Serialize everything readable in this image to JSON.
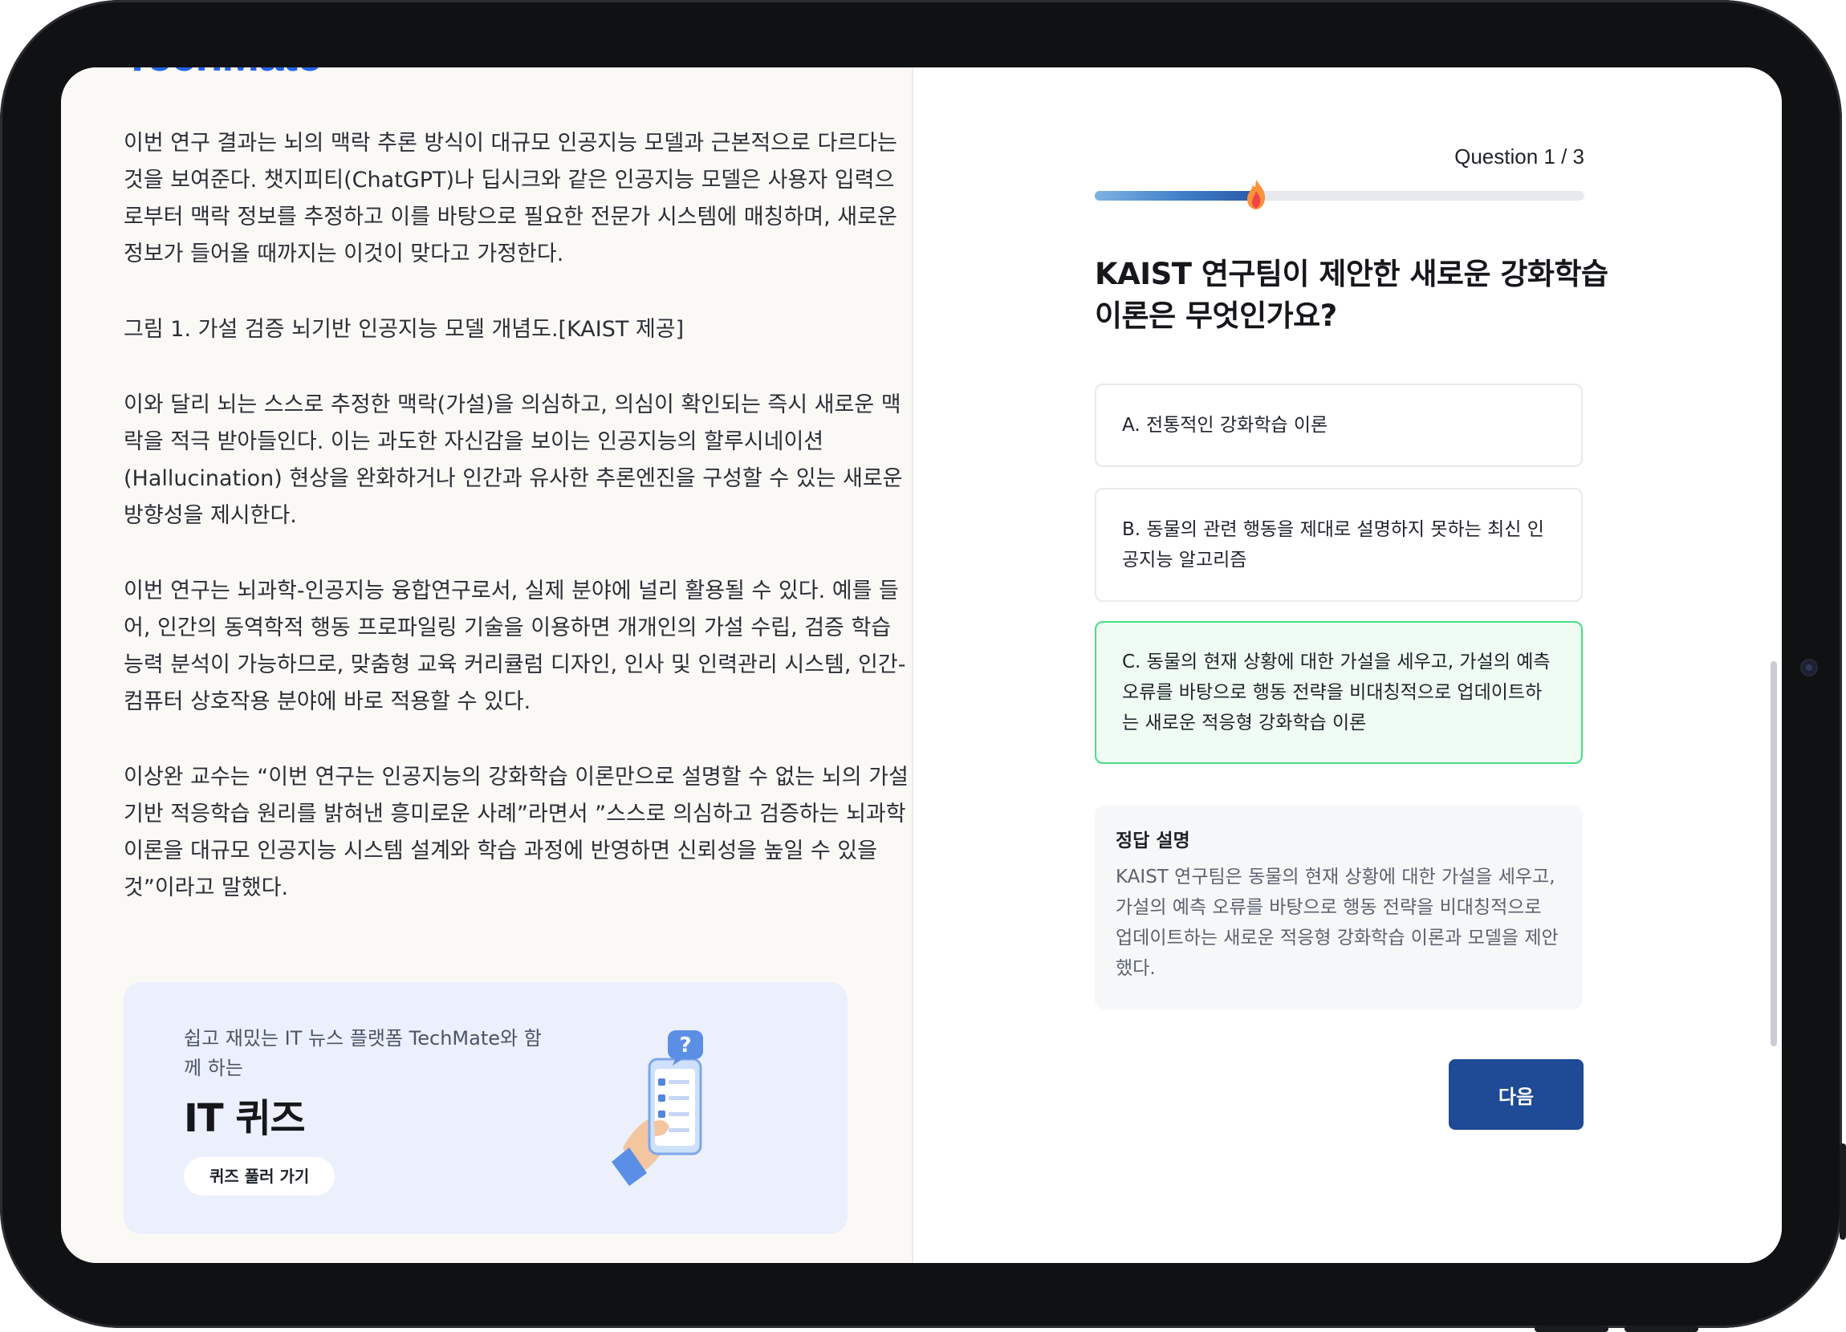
{
  "brand": {
    "logo": "TechMate"
  },
  "article": {
    "paragraphs": [
      "이번 연구 결과는 뇌의 맥락 추론 방식이 대규모 인공지능 모델과 근본적으로 다르다는 것을 보여준다. 챗지피티(ChatGPT)나 딥시크와 같은 인공지능 모델은 사용자 입력으로부터 맥락 정보를 추정하고 이를 바탕으로 필요한 전문가 시스템에 매칭하며, 새로운 정보가 들어올 때까지는 이것이 맞다고 가정한다.",
      "그림 1. 가설 검증 뇌기반 인공지능 모델 개념도.[KAIST 제공]",
      "이와 달리 뇌는 스스로 추정한 맥락(가설)을 의심하고, 의심이 확인되는 즉시 새로운 맥락을 적극 받아들인다. 이는 과도한 자신감을 보이는 인공지능의 할루시네이션(Hallucination) 현상을 완화하거나 인간과 유사한 추론엔진을 구성할 수 있는 새로운 방향성을 제시한다.",
      "이번 연구는 뇌과학-인공지능 융합연구로서, 실제 분야에 널리 활용될 수 있다. 예를 들어, 인간의 동역학적 행동 프로파일링 기술을 이용하면 개개인의 가설 수립, 검증 학습 능력 분석이 가능하므로, 맞춤형 교육 커리큘럼 디자인, 인사 및 인력관리 시스템, 인간-컴퓨터 상호작용 분야에 바로 적용할 수 있다.",
      "이상완 교수는 “이번 연구는 인공지능의 강화학습 이론만으로 설명할 수 없는 뇌의 가설 기반 적응학습 원리를 밝혀낸 흥미로운 사례”라면서 ”스스로 의심하고 검증하는 뇌과학 이론을 대규모 인공지능 시스템 설계와 학습 과정에 반영하면 신뢰성을 높일 수 있을 것”이라고 말했다."
    ]
  },
  "promo": {
    "subtitle": "쉽고 재밌는 IT 뉴스 플랫폼 TechMate와 함께 하는",
    "title": "IT 퀴즈",
    "button": "퀴즈 풀러 가기"
  },
  "quiz": {
    "counter": "Question 1 / 3",
    "progress": 0.33,
    "question": "KAIST 연구팀이 제안한 새로운 강화학습 이론은 무엇인가요?",
    "options": [
      {
        "label": "A. 전통적인 강화학습 이론",
        "selected": false
      },
      {
        "label": "B. 동물의 관련 행동을 제대로 설명하지 못하는 최신 인공지능 알고리즘",
        "selected": false
      },
      {
        "label": "C. 동물의 현재 상황에 대한 가설을 세우고, 가설의 예측 오류를 바탕으로 행동 전략을 비대칭적으로 업데이트하는 새로운 적응형 강화학습 이론",
        "selected": true
      }
    ],
    "explanation": {
      "title": "정답 설명",
      "body": "KAIST 연구팀은 동물의 현재 상황에 대한 가설을 세우고, 가설의 예측 오류를 바탕으로 행동 전략을 비대칭적으로 업데이트하는 새로운 적응형 강화학습 이론과 모델을 제안했다."
    },
    "next_label": "다음"
  },
  "colors": {
    "brand_blue": "#2563eb",
    "next_button": "#1e4a96",
    "selected_border": "#4ade80",
    "selected_bg": "#eefcf3",
    "promo_bg": "#ecf0fd"
  },
  "icons": [
    "flame-icon",
    "phone-quiz-illustration",
    "question-bubble-icon",
    "checklist-icon"
  ]
}
